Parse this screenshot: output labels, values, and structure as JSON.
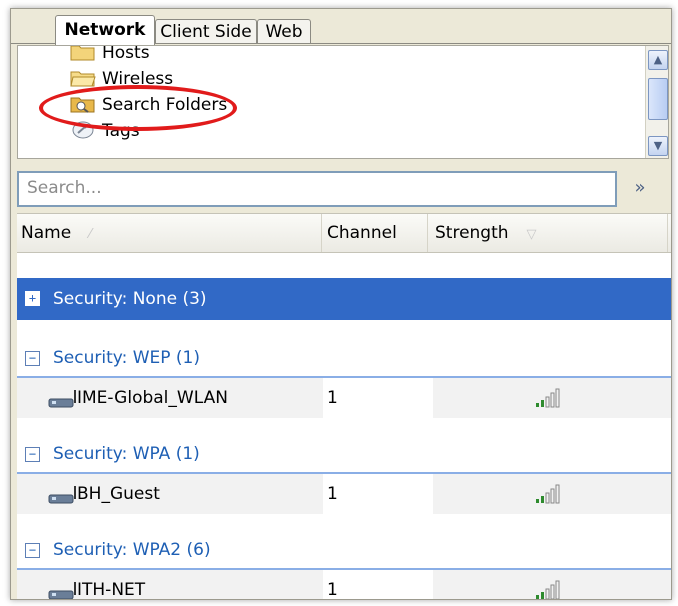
{
  "tabs": [
    {
      "label": "Network",
      "active": true
    },
    {
      "label": "Client Side",
      "active": false
    },
    {
      "label": "Web",
      "active": false
    }
  ],
  "tree": {
    "items": [
      {
        "label": "Hosts",
        "icon": "folder-icon"
      },
      {
        "label": "Wireless",
        "icon": "folder-open-icon",
        "highlighted": true
      },
      {
        "label": "Search Folders",
        "icon": "search-folder-icon"
      },
      {
        "label": "Tags",
        "icon": "tag-icon"
      }
    ]
  },
  "search": {
    "placeholder": "Search..."
  },
  "columns": [
    {
      "label": "Name"
    },
    {
      "label": "Channel"
    },
    {
      "label": "Strength"
    }
  ],
  "groups": [
    {
      "label": "Security: None (3)",
      "expanded": false,
      "selected": true,
      "rows": []
    },
    {
      "label": "Security: WEP (1)",
      "expanded": true,
      "selected": false,
      "rows": [
        {
          "name": "IME-Global_WLAN",
          "channel": "1",
          "strength_bars": 2
        }
      ]
    },
    {
      "label": "Security: WPA (1)",
      "expanded": true,
      "selected": false,
      "rows": [
        {
          "name": "BH_Guest",
          "channel": "1",
          "strength_bars": 2
        }
      ]
    },
    {
      "label": "Security: WPA2 (6)",
      "expanded": true,
      "selected": false,
      "rows": [
        {
          "name": "ITH-NET",
          "channel": "1",
          "strength_bars": 2
        }
      ]
    }
  ],
  "toggle_symbols": {
    "collapsed": "+",
    "expanded": "−"
  },
  "colors": {
    "selection": "#3169c6",
    "group_text": "#1e5fb4",
    "highlight_circle": "#e11b1b"
  }
}
